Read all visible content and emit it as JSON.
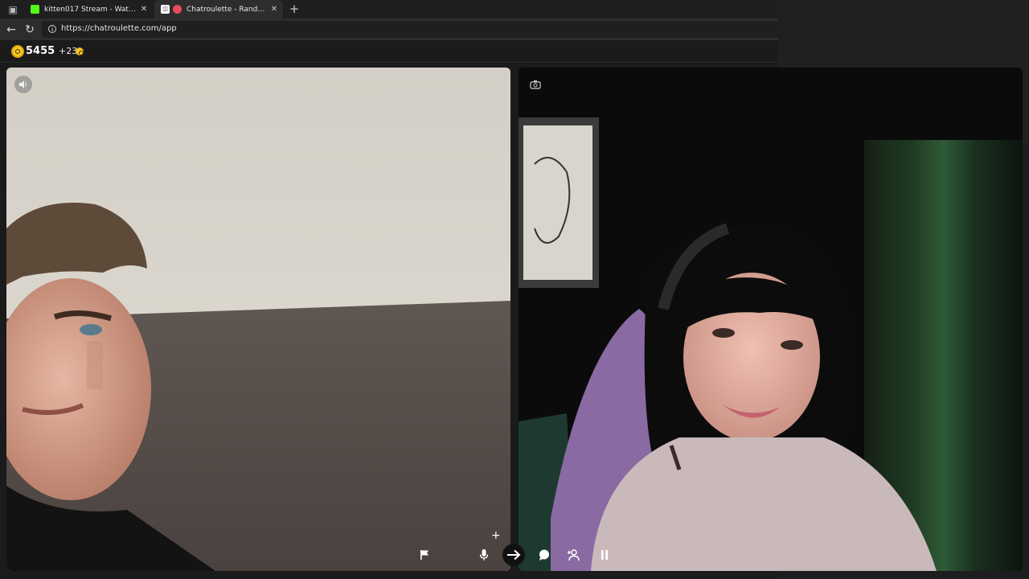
{
  "browser": {
    "tabs": [
      {
        "title": "kitten017 Stream - Watch Live on Kick",
        "favicon_color": "#53fc18",
        "active": false
      },
      {
        "title": "Chatroulette - Random video chat",
        "favicon_color": "#e84b5c",
        "active": true
      }
    ],
    "new_tab_icon": "plus-icon",
    "url": "https://chatroulette.com/app"
  },
  "coins": {
    "balance": "5455",
    "bonus": "+23"
  },
  "videos": {
    "left_overlay_icon": "speaker-icon",
    "right_overlay_icon": "camera-switch-icon"
  },
  "controls": [
    {
      "name": "report",
      "icon": "flag-icon"
    },
    {
      "name": "mute",
      "icon": "mic-icon"
    },
    {
      "name": "next",
      "icon": "arrow-right-icon"
    },
    {
      "name": "chat",
      "icon": "chat-bubble-icon"
    },
    {
      "name": "add-friend",
      "icon": "add-user-icon"
    },
    {
      "name": "pause",
      "icon": "pause-icon"
    }
  ],
  "colors": {
    "coin_gold": "#f7c924",
    "app_bg": "#1b1b1c",
    "chrome_bg": "#202124"
  }
}
